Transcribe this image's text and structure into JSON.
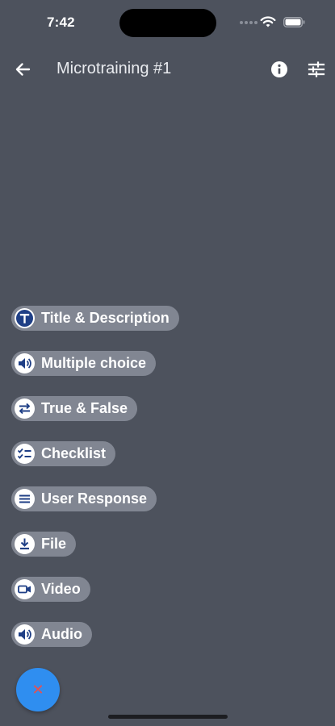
{
  "status_bar": {
    "time": "7:42"
  },
  "header": {
    "title": "Microtraining #1",
    "back_icon": "arrow-left-icon",
    "info_icon": "info-icon",
    "settings_icon": "tune-sliders-icon"
  },
  "menu": {
    "items": [
      {
        "label": "Title & Description",
        "icon": "title-t-icon"
      },
      {
        "label": "Multiple choice",
        "icon": "speaker-icon"
      },
      {
        "label": "True & False",
        "icon": "swap-icon"
      },
      {
        "label": "Checklist",
        "icon": "checklist-icon"
      },
      {
        "label": "User Response",
        "icon": "lines-icon"
      },
      {
        "label": "File",
        "icon": "download-icon"
      },
      {
        "label": "Video",
        "icon": "video-camera-icon"
      },
      {
        "label": "Audio",
        "icon": "speaker-icon"
      }
    ]
  },
  "fab": {
    "symbol": "✕",
    "icon": "close-icon"
  },
  "colors": {
    "background": "#4d525d",
    "chip": "#818692",
    "chip_icon_fg": "#1f3f86",
    "fab": "#2f8ef0",
    "fab_icon": "#e8504f"
  }
}
